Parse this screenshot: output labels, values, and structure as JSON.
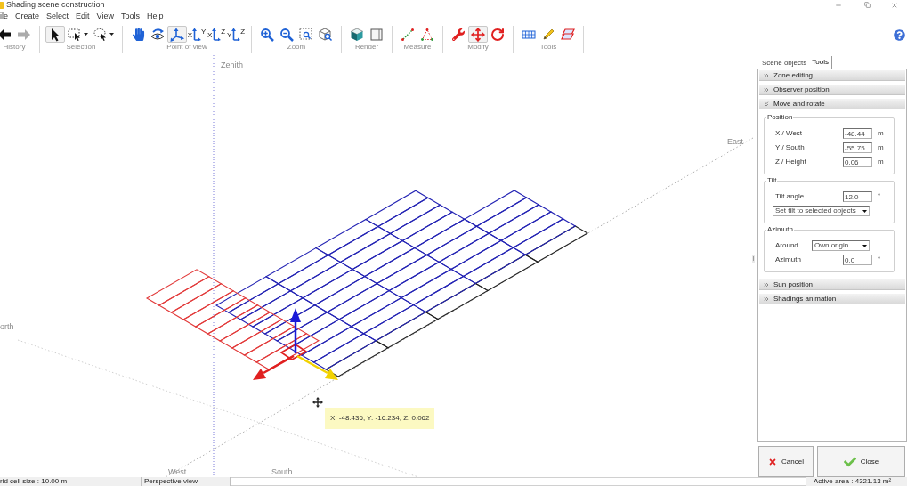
{
  "window": {
    "title": "Shading scene construction"
  },
  "menu": [
    "ile",
    "Create",
    "Select",
    "Edit",
    "View",
    "Tools",
    "Help"
  ],
  "toolbar": {
    "groups": [
      {
        "label": "History",
        "buttons": [
          {
            "kind": "back",
            "selected": false,
            "disabled": false,
            "dropdown": false
          },
          {
            "kind": "forward",
            "selected": false,
            "disabled": true,
            "dropdown": false
          }
        ]
      },
      {
        "label": "Selection",
        "buttons": [
          {
            "kind": "pointer",
            "selected": true,
            "disabled": false,
            "dropdown": false
          },
          {
            "kind": "rect-select",
            "selected": false,
            "disabled": false,
            "dropdown": true
          },
          {
            "kind": "lasso",
            "selected": false,
            "disabled": false,
            "dropdown": true
          }
        ]
      },
      {
        "label": "Point of view",
        "buttons": [
          {
            "kind": "pan",
            "selected": false,
            "disabled": false,
            "dropdown": false
          },
          {
            "kind": "orbit",
            "selected": false,
            "disabled": false,
            "dropdown": false
          },
          {
            "kind": "axes-3d",
            "selected": true,
            "disabled": false,
            "dropdown": false
          },
          {
            "kind": "axes-2d",
            "selected": false,
            "disabled": false,
            "dropdown": false,
            "axis_labels": {
              "horizontal": "X",
              "vertical": "Y"
            }
          },
          {
            "kind": "axes-2d",
            "selected": false,
            "disabled": false,
            "dropdown": false,
            "axis_labels": {
              "horizontal": "X",
              "vertical": "Z"
            }
          },
          {
            "kind": "axes-2d",
            "selected": false,
            "disabled": false,
            "dropdown": false,
            "axis_labels": {
              "horizontal": "Y",
              "vertical": "Z"
            }
          }
        ]
      },
      {
        "label": "Zoom",
        "buttons": [
          {
            "kind": "zoom-in",
            "selected": false,
            "disabled": false,
            "dropdown": false
          },
          {
            "kind": "zoom-out",
            "selected": false,
            "disabled": false,
            "dropdown": false
          },
          {
            "kind": "zoom-rect",
            "selected": false,
            "disabled": false,
            "dropdown": false
          },
          {
            "kind": "zoom-box",
            "selected": false,
            "disabled": false,
            "dropdown": false
          }
        ]
      },
      {
        "label": "Render",
        "buttons": [
          {
            "kind": "render-solid",
            "selected": false,
            "disabled": false,
            "dropdown": false
          },
          {
            "kind": "render-wire",
            "selected": false,
            "disabled": false,
            "dropdown": false
          }
        ]
      },
      {
        "label": "Measure",
        "buttons": [
          {
            "kind": "measure-line",
            "selected": false,
            "disabled": false,
            "dropdown": false
          },
          {
            "kind": "measure-angle",
            "selected": false,
            "disabled": false,
            "dropdown": false
          }
        ]
      },
      {
        "label": "Modify",
        "buttons": [
          {
            "kind": "wrench",
            "selected": false,
            "disabled": false,
            "dropdown": false
          },
          {
            "kind": "move",
            "selected": true,
            "disabled": false,
            "dropdown": false
          },
          {
            "kind": "rotate",
            "selected": false,
            "disabled": false,
            "dropdown": false
          }
        ]
      },
      {
        "label": "Tools",
        "buttons": [
          {
            "kind": "grid",
            "selected": false,
            "disabled": false,
            "dropdown": false
          },
          {
            "kind": "pencil",
            "selected": false,
            "disabled": false,
            "dropdown": false
          },
          {
            "kind": "frames",
            "selected": false,
            "disabled": false,
            "dropdown": false
          }
        ]
      }
    ]
  },
  "canvas": {
    "axis_labels": [
      {
        "kind": "zenith",
        "text": "Zenith"
      },
      {
        "kind": "east",
        "text": "East"
      },
      {
        "kind": "north",
        "text": "orth"
      },
      {
        "kind": "west",
        "text": "West"
      },
      {
        "kind": "south",
        "text": "South"
      }
    ],
    "tooltip": "X: -48.436, Y: -16.234, Z: 0.062"
  },
  "panel": {
    "tabs": [
      {
        "label": "Scene objects",
        "selected": false
      },
      {
        "label": "Tools",
        "selected": true
      }
    ],
    "sections": [
      {
        "title": "Zone editing",
        "expanded": false
      },
      {
        "title": "Observer position",
        "expanded": false
      },
      {
        "title": "Move and rotate",
        "expanded": true,
        "groups": [
          {
            "title": "Position",
            "rows": [
              {
                "kind": "number",
                "label": "X / West",
                "value": "-48.44",
                "unit": "m"
              },
              {
                "kind": "number",
                "label": "Y / South",
                "value": "-55.75",
                "unit": "m"
              },
              {
                "kind": "number",
                "label": "Z / Height",
                "value": "0.06",
                "unit": "m"
              }
            ]
          },
          {
            "title": "Tilt",
            "rows": [
              {
                "kind": "number",
                "label": "Tilt angle",
                "value": "12.0",
                "unit": "°"
              },
              {
                "kind": "dropdown",
                "value": "Set tilt to selected objects"
              }
            ]
          },
          {
            "title": "Azimuth",
            "rows": [
              {
                "kind": "dropdown",
                "label": "Around",
                "value": "Own origin"
              },
              {
                "kind": "number",
                "label": "Azimuth",
                "value": "0.0",
                "unit": "°"
              }
            ]
          }
        ]
      },
      {
        "title": "Sun position",
        "expanded": false
      },
      {
        "title": "Shadings animation",
        "expanded": false
      }
    ],
    "buttons": [
      {
        "kind": "cancel",
        "label": "Cancel"
      },
      {
        "kind": "close",
        "label": "Close"
      }
    ]
  },
  "status_bar": {
    "grid": "rid cell size : 10.00 m",
    "view": "Perspective view",
    "area": "Active area : 4321.13 m²"
  }
}
